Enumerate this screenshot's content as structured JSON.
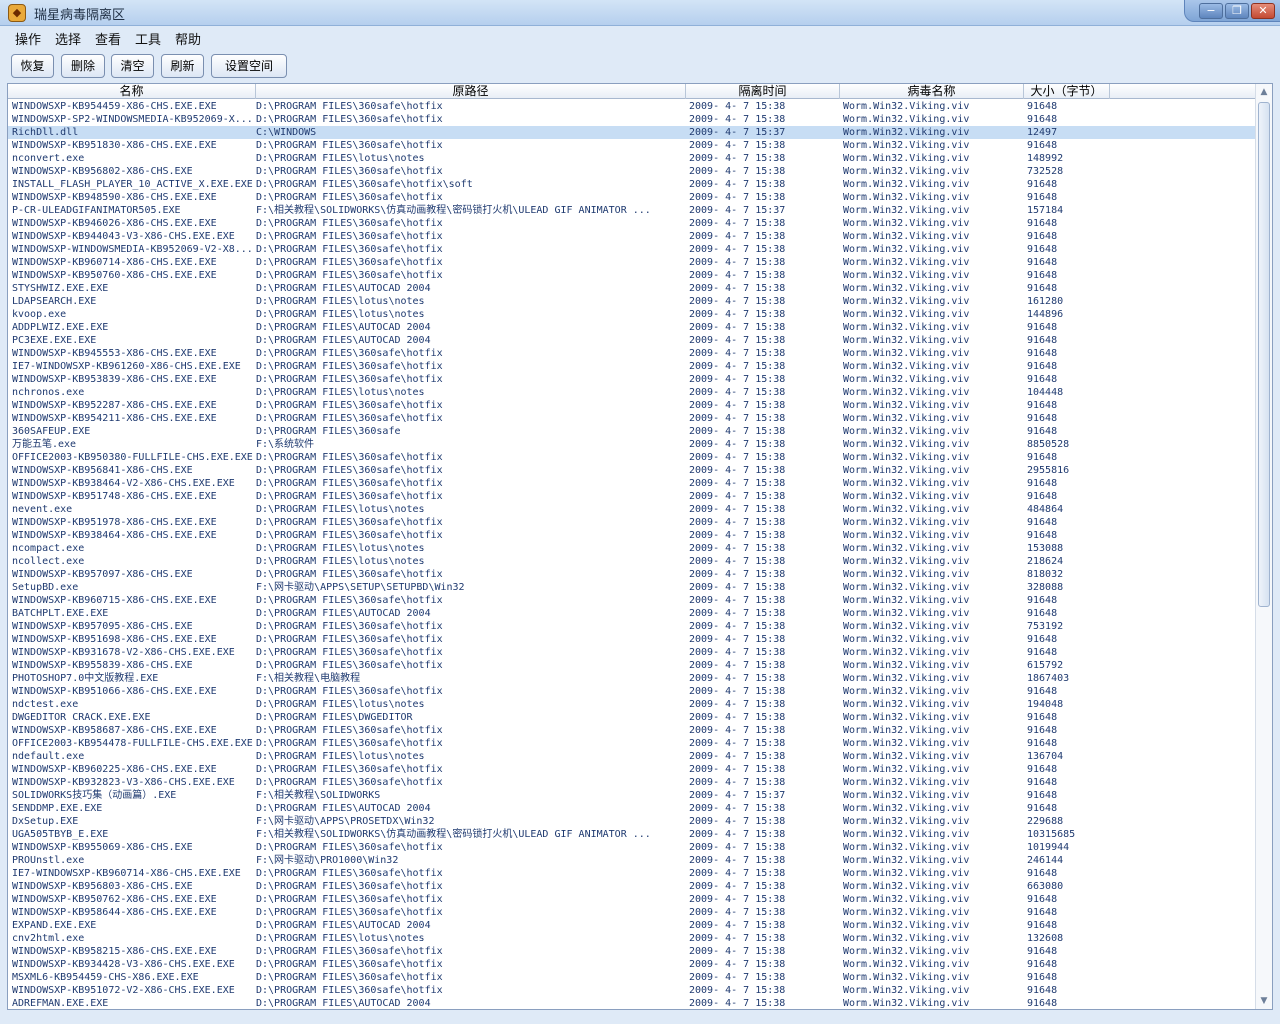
{
  "window": {
    "title": "瑞星病毒隔离区",
    "app_icon": "shield-icon"
  },
  "menu": [
    "操作",
    "选择",
    "查看",
    "工具",
    "帮助"
  ],
  "toolbar": [
    "恢复",
    "删除",
    "清空",
    "刷新",
    "设置空间"
  ],
  "columns": [
    "名称",
    "原路径",
    "隔离时间",
    "病毒名称",
    "大小（字节）"
  ],
  "selected_row": 2,
  "rows": [
    [
      "WINDOWSXP-KB954459-X86-CHS.EXE.EXE",
      "D:\\PROGRAM FILES\\360safe\\hotfix",
      "2009- 4- 7 15:38",
      "Worm.Win32.Viking.viv",
      "91648"
    ],
    [
      "WINDOWSXP-SP2-WINDOWSMEDIA-KB952069-X...",
      "D:\\PROGRAM FILES\\360safe\\hotfix",
      "2009- 4- 7 15:38",
      "Worm.Win32.Viking.viv",
      "91648"
    ],
    [
      "RichDll.dll",
      "C:\\WINDOWS",
      "2009- 4- 7 15:37",
      "Worm.Win32.Viking.viv",
      "12497"
    ],
    [
      "WINDOWSXP-KB951830-X86-CHS.EXE.EXE",
      "D:\\PROGRAM FILES\\360safe\\hotfix",
      "2009- 4- 7 15:38",
      "Worm.Win32.Viking.viv",
      "91648"
    ],
    [
      "nconvert.exe",
      "D:\\PROGRAM FILES\\lotus\\notes",
      "2009- 4- 7 15:38",
      "Worm.Win32.Viking.viv",
      "148992"
    ],
    [
      "WINDOWSXP-KB956802-X86-CHS.EXE",
      "D:\\PROGRAM FILES\\360safe\\hotfix",
      "2009- 4- 7 15:38",
      "Worm.Win32.Viking.viv",
      "732528"
    ],
    [
      "INSTALL_FLASH_PLAYER_10_ACTIVE_X.EXE.EXE",
      "D:\\PROGRAM FILES\\360safe\\hotfix\\soft",
      "2009- 4- 7 15:38",
      "Worm.Win32.Viking.viv",
      "91648"
    ],
    [
      "WINDOWSXP-KB948590-X86-CHS.EXE.EXE",
      "D:\\PROGRAM FILES\\360safe\\hotfix",
      "2009- 4- 7 15:38",
      "Worm.Win32.Viking.viv",
      "91648"
    ],
    [
      "P-CR-ULEADGIFANIMATOR505.EXE",
      "F:\\相关教程\\SOLIDWORKS\\仿真动画教程\\密码锁打火机\\ULEAD GIF ANIMATOR ...",
      "2009- 4- 7 15:37",
      "Worm.Win32.Viking.viv",
      "157184"
    ],
    [
      "WINDOWSXP-KB946026-X86-CHS.EXE.EXE",
      "D:\\PROGRAM FILES\\360safe\\hotfix",
      "2009- 4- 7 15:38",
      "Worm.Win32.Viking.viv",
      "91648"
    ],
    [
      "WINDOWSXP-KB944043-V3-X86-CHS.EXE.EXE",
      "D:\\PROGRAM FILES\\360safe\\hotfix",
      "2009- 4- 7 15:38",
      "Worm.Win32.Viking.viv",
      "91648"
    ],
    [
      "WINDOWSXP-WINDOWSMEDIA-KB952069-V2-X8...",
      "D:\\PROGRAM FILES\\360safe\\hotfix",
      "2009- 4- 7 15:38",
      "Worm.Win32.Viking.viv",
      "91648"
    ],
    [
      "WINDOWSXP-KB960714-X86-CHS.EXE.EXE",
      "D:\\PROGRAM FILES\\360safe\\hotfix",
      "2009- 4- 7 15:38",
      "Worm.Win32.Viking.viv",
      "91648"
    ],
    [
      "WINDOWSXP-KB950760-X86-CHS.EXE.EXE",
      "D:\\PROGRAM FILES\\360safe\\hotfix",
      "2009- 4- 7 15:38",
      "Worm.Win32.Viking.viv",
      "91648"
    ],
    [
      "STYSHWIZ.EXE.EXE",
      "D:\\PROGRAM FILES\\AUTOCAD 2004",
      "2009- 4- 7 15:38",
      "Worm.Win32.Viking.viv",
      "91648"
    ],
    [
      "LDAPSEARCH.EXE",
      "D:\\PROGRAM FILES\\lotus\\notes",
      "2009- 4- 7 15:38",
      "Worm.Win32.Viking.viv",
      "161280"
    ],
    [
      "kvoop.exe",
      "D:\\PROGRAM FILES\\lotus\\notes",
      "2009- 4- 7 15:38",
      "Worm.Win32.Viking.viv",
      "144896"
    ],
    [
      "ADDPLWIZ.EXE.EXE",
      "D:\\PROGRAM FILES\\AUTOCAD 2004",
      "2009- 4- 7 15:38",
      "Worm.Win32.Viking.viv",
      "91648"
    ],
    [
      "PC3EXE.EXE.EXE",
      "D:\\PROGRAM FILES\\AUTOCAD 2004",
      "2009- 4- 7 15:38",
      "Worm.Win32.Viking.viv",
      "91648"
    ],
    [
      "WINDOWSXP-KB945553-X86-CHS.EXE.EXE",
      "D:\\PROGRAM FILES\\360safe\\hotfix",
      "2009- 4- 7 15:38",
      "Worm.Win32.Viking.viv",
      "91648"
    ],
    [
      "IE7-WINDOWSXP-KB961260-X86-CHS.EXE.EXE",
      "D:\\PROGRAM FILES\\360safe\\hotfix",
      "2009- 4- 7 15:38",
      "Worm.Win32.Viking.viv",
      "91648"
    ],
    [
      "WINDOWSXP-KB953839-X86-CHS.EXE.EXE",
      "D:\\PROGRAM FILES\\360safe\\hotfix",
      "2009- 4- 7 15:38",
      "Worm.Win32.Viking.viv",
      "91648"
    ],
    [
      "nchronos.exe",
      "D:\\PROGRAM FILES\\lotus\\notes",
      "2009- 4- 7 15:38",
      "Worm.Win32.Viking.viv",
      "104448"
    ],
    [
      "WINDOWSXP-KB952287-X86-CHS.EXE.EXE",
      "D:\\PROGRAM FILES\\360safe\\hotfix",
      "2009- 4- 7 15:38",
      "Worm.Win32.Viking.viv",
      "91648"
    ],
    [
      "WINDOWSXP-KB954211-X86-CHS.EXE.EXE",
      "D:\\PROGRAM FILES\\360safe\\hotfix",
      "2009- 4- 7 15:38",
      "Worm.Win32.Viking.viv",
      "91648"
    ],
    [
      "360SAFEUP.EXE",
      "D:\\PROGRAM FILES\\360safe",
      "2009- 4- 7 15:38",
      "Worm.Win32.Viking.viv",
      "91648"
    ],
    [
      "万能五笔.exe",
      "F:\\系统软件",
      "2009- 4- 7 15:38",
      "Worm.Win32.Viking.viv",
      "8850528"
    ],
    [
      "OFFICE2003-KB950380-FULLFILE-CHS.EXE.EXE",
      "D:\\PROGRAM FILES\\360safe\\hotfix",
      "2009- 4- 7 15:38",
      "Worm.Win32.Viking.viv",
      "91648"
    ],
    [
      "WINDOWSXP-KB956841-X86-CHS.EXE",
      "D:\\PROGRAM FILES\\360safe\\hotfix",
      "2009- 4- 7 15:38",
      "Worm.Win32.Viking.viv",
      "2955816"
    ],
    [
      "WINDOWSXP-KB938464-V2-X86-CHS.EXE.EXE",
      "D:\\PROGRAM FILES\\360safe\\hotfix",
      "2009- 4- 7 15:38",
      "Worm.Win32.Viking.viv",
      "91648"
    ],
    [
      "WINDOWSXP-KB951748-X86-CHS.EXE.EXE",
      "D:\\PROGRAM FILES\\360safe\\hotfix",
      "2009- 4- 7 15:38",
      "Worm.Win32.Viking.viv",
      "91648"
    ],
    [
      "nevent.exe",
      "D:\\PROGRAM FILES\\lotus\\notes",
      "2009- 4- 7 15:38",
      "Worm.Win32.Viking.viv",
      "484864"
    ],
    [
      "WINDOWSXP-KB951978-X86-CHS.EXE.EXE",
      "D:\\PROGRAM FILES\\360safe\\hotfix",
      "2009- 4- 7 15:38",
      "Worm.Win32.Viking.viv",
      "91648"
    ],
    [
      "WINDOWSXP-KB938464-X86-CHS.EXE.EXE",
      "D:\\PROGRAM FILES\\360safe\\hotfix",
      "2009- 4- 7 15:38",
      "Worm.Win32.Viking.viv",
      "91648"
    ],
    [
      "ncompact.exe",
      "D:\\PROGRAM FILES\\lotus\\notes",
      "2009- 4- 7 15:38",
      "Worm.Win32.Viking.viv",
      "153088"
    ],
    [
      "ncollect.exe",
      "D:\\PROGRAM FILES\\lotus\\notes",
      "2009- 4- 7 15:38",
      "Worm.Win32.Viking.viv",
      "218624"
    ],
    [
      "WINDOWSXP-KB957097-X86-CHS.EXE",
      "D:\\PROGRAM FILES\\360safe\\hotfix",
      "2009- 4- 7 15:38",
      "Worm.Win32.Viking.viv",
      "818032"
    ],
    [
      "SetupBD.exe",
      "F:\\网卡驱动\\APPS\\SETUP\\SETUPBD\\Win32",
      "2009- 4- 7 15:38",
      "Worm.Win32.Viking.viv",
      "328088"
    ],
    [
      "WINDOWSXP-KB960715-X86-CHS.EXE.EXE",
      "D:\\PROGRAM FILES\\360safe\\hotfix",
      "2009- 4- 7 15:38",
      "Worm.Win32.Viking.viv",
      "91648"
    ],
    [
      "BATCHPLT.EXE.EXE",
      "D:\\PROGRAM FILES\\AUTOCAD 2004",
      "2009- 4- 7 15:38",
      "Worm.Win32.Viking.viv",
      "91648"
    ],
    [
      "WINDOWSXP-KB957095-X86-CHS.EXE",
      "D:\\PROGRAM FILES\\360safe\\hotfix",
      "2009- 4- 7 15:38",
      "Worm.Win32.Viking.viv",
      "753192"
    ],
    [
      "WINDOWSXP-KB951698-X86-CHS.EXE.EXE",
      "D:\\PROGRAM FILES\\360safe\\hotfix",
      "2009- 4- 7 15:38",
      "Worm.Win32.Viking.viv",
      "91648"
    ],
    [
      "WINDOWSXP-KB931678-V2-X86-CHS.EXE.EXE",
      "D:\\PROGRAM FILES\\360safe\\hotfix",
      "2009- 4- 7 15:38",
      "Worm.Win32.Viking.viv",
      "91648"
    ],
    [
      "WINDOWSXP-KB955839-X86-CHS.EXE",
      "D:\\PROGRAM FILES\\360safe\\hotfix",
      "2009- 4- 7 15:38",
      "Worm.Win32.Viking.viv",
      "615792"
    ],
    [
      "PHOTOSHOP7.0中文版教程.EXE",
      "F:\\相关教程\\电脑教程",
      "2009- 4- 7 15:38",
      "Worm.Win32.Viking.viv",
      "1867403"
    ],
    [
      "WINDOWSXP-KB951066-X86-CHS.EXE.EXE",
      "D:\\PROGRAM FILES\\360safe\\hotfix",
      "2009- 4- 7 15:38",
      "Worm.Win32.Viking.viv",
      "91648"
    ],
    [
      "ndctest.exe",
      "D:\\PROGRAM FILES\\lotus\\notes",
      "2009- 4- 7 15:38",
      "Worm.Win32.Viking.viv",
      "194048"
    ],
    [
      "DWGEDITOR CRACK.EXE.EXE",
      "D:\\PROGRAM FILES\\DWGEDITOR",
      "2009- 4- 7 15:38",
      "Worm.Win32.Viking.viv",
      "91648"
    ],
    [
      "WINDOWSXP-KB958687-X86-CHS.EXE.EXE",
      "D:\\PROGRAM FILES\\360safe\\hotfix",
      "2009- 4- 7 15:38",
      "Worm.Win32.Viking.viv",
      "91648"
    ],
    [
      "OFFICE2003-KB954478-FULLFILE-CHS.EXE.EXE",
      "D:\\PROGRAM FILES\\360safe\\hotfix",
      "2009- 4- 7 15:38",
      "Worm.Win32.Viking.viv",
      "91648"
    ],
    [
      "ndefault.exe",
      "D:\\PROGRAM FILES\\lotus\\notes",
      "2009- 4- 7 15:38",
      "Worm.Win32.Viking.viv",
      "136704"
    ],
    [
      "WINDOWSXP-KB960225-X86-CHS.EXE.EXE",
      "D:\\PROGRAM FILES\\360safe\\hotfix",
      "2009- 4- 7 15:38",
      "Worm.Win32.Viking.viv",
      "91648"
    ],
    [
      "WINDOWSXP-KB932823-V3-X86-CHS.EXE.EXE",
      "D:\\PROGRAM FILES\\360safe\\hotfix",
      "2009- 4- 7 15:38",
      "Worm.Win32.Viking.viv",
      "91648"
    ],
    [
      "SOLIDWORKS技巧集（动画篇）.EXE",
      "F:\\相关教程\\SOLIDWORKS",
      "2009- 4- 7 15:37",
      "Worm.Win32.Viking.viv",
      "91648"
    ],
    [
      "SENDDMP.EXE.EXE",
      "D:\\PROGRAM FILES\\AUTOCAD 2004",
      "2009- 4- 7 15:38",
      "Worm.Win32.Viking.viv",
      "91648"
    ],
    [
      "DxSetup.EXE",
      "F:\\网卡驱动\\APPS\\PROSETDX\\Win32",
      "2009- 4- 7 15:38",
      "Worm.Win32.Viking.viv",
      "229688"
    ],
    [
      "UGA505TBYB_E.EXE",
      "F:\\相关教程\\SOLIDWORKS\\仿真动画教程\\密码锁打火机\\ULEAD GIF ANIMATOR ...",
      "2009- 4- 7 15:38",
      "Worm.Win32.Viking.viv",
      "10315685"
    ],
    [
      "WINDOWSXP-KB955069-X86-CHS.EXE",
      "D:\\PROGRAM FILES\\360safe\\hotfix",
      "2009- 4- 7 15:38",
      "Worm.Win32.Viking.viv",
      "1019944"
    ],
    [
      "PROUnstl.exe",
      "F:\\网卡驱动\\PRO1000\\Win32",
      "2009- 4- 7 15:38",
      "Worm.Win32.Viking.viv",
      "246144"
    ],
    [
      "IE7-WINDOWSXP-KB960714-X86-CHS.EXE.EXE",
      "D:\\PROGRAM FILES\\360safe\\hotfix",
      "2009- 4- 7 15:38",
      "Worm.Win32.Viking.viv",
      "91648"
    ],
    [
      "WINDOWSXP-KB956803-X86-CHS.EXE",
      "D:\\PROGRAM FILES\\360safe\\hotfix",
      "2009- 4- 7 15:38",
      "Worm.Win32.Viking.viv",
      "663080"
    ],
    [
      "WINDOWSXP-KB950762-X86-CHS.EXE.EXE",
      "D:\\PROGRAM FILES\\360safe\\hotfix",
      "2009- 4- 7 15:38",
      "Worm.Win32.Viking.viv",
      "91648"
    ],
    [
      "WINDOWSXP-KB958644-X86-CHS.EXE.EXE",
      "D:\\PROGRAM FILES\\360safe\\hotfix",
      "2009- 4- 7 15:38",
      "Worm.Win32.Viking.viv",
      "91648"
    ],
    [
      "EXPAND.EXE.EXE",
      "D:\\PROGRAM FILES\\AUTOCAD 2004",
      "2009- 4- 7 15:38",
      "Worm.Win32.Viking.viv",
      "91648"
    ],
    [
      "cnv2html.exe",
      "D:\\PROGRAM FILES\\lotus\\notes",
      "2009- 4- 7 15:38",
      "Worm.Win32.Viking.viv",
      "132608"
    ],
    [
      "WINDOWSXP-KB958215-X86-CHS.EXE.EXE",
      "D:\\PROGRAM FILES\\360safe\\hotfix",
      "2009- 4- 7 15:38",
      "Worm.Win32.Viking.viv",
      "91648"
    ],
    [
      "WINDOWSXP-KB934428-V3-X86-CHS.EXE.EXE",
      "D:\\PROGRAM FILES\\360safe\\hotfix",
      "2009- 4- 7 15:38",
      "Worm.Win32.Viking.viv",
      "91648"
    ],
    [
      "MSXML6-KB954459-CHS-X86.EXE.EXE",
      "D:\\PROGRAM FILES\\360safe\\hotfix",
      "2009- 4- 7 15:38",
      "Worm.Win32.Viking.viv",
      "91648"
    ],
    [
      "WINDOWSXP-KB951072-V2-X86-CHS.EXE.EXE",
      "D:\\PROGRAM FILES\\360safe\\hotfix",
      "2009- 4- 7 15:38",
      "Worm.Win32.Viking.viv",
      "91648"
    ],
    [
      "ADREFMAN.EXE.EXE",
      "D:\\PROGRAM FILES\\AUTOCAD 2004",
      "2009- 4- 7 15:38",
      "Worm.Win32.Viking.viv",
      "91648"
    ]
  ]
}
